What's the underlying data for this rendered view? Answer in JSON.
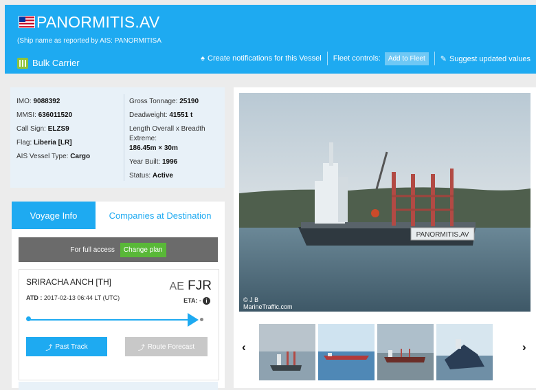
{
  "header": {
    "vessel_name": "PANORMITIS.AV",
    "reported_name": "(Ship name as reported by AIS: PANORMITISA",
    "vessel_type": "Bulk Carrier",
    "actions": {
      "create_notifications": "Create notifications for this Vessel",
      "fleet_controls": "Fleet controls:",
      "add_to_fleet": "Add to Fleet",
      "suggest_values": "Suggest updated values"
    }
  },
  "info": {
    "imo": {
      "label": "IMO:",
      "value": "9088392"
    },
    "mmsi": {
      "label": "MMSI:",
      "value": "636011520"
    },
    "callsign": {
      "label": "Call Sign:",
      "value": "ELZS9"
    },
    "flag": {
      "label": "Flag:",
      "value": "Liberia [LR]"
    },
    "ais_type": {
      "label": "AIS Vessel Type:",
      "value": "Cargo"
    },
    "gross_tonnage": {
      "label": "Gross Tonnage:",
      "value": "25190"
    },
    "deadweight": {
      "label": "Deadweight:",
      "value": "41551 t"
    },
    "length_label": "Length Overall x Breadth Extreme:",
    "length_value": "186.45m × 30m",
    "year_built": {
      "label": "Year Built:",
      "value": "1996"
    },
    "status": {
      "label": "Status:",
      "value": "Active"
    }
  },
  "tabs": {
    "voyage": "Voyage Info",
    "companies": "Companies at Destination"
  },
  "voyage": {
    "full_access": "For full access",
    "change_plan": "Change plan",
    "from": "SRIRACHA ANCH [TH]",
    "atd_label": "ATD :",
    "atd_value": "2017-02-13 06:44 LT (UTC)",
    "dest_code_a": "AE",
    "dest_code_b": "FJR",
    "eta_label": "ETA: -",
    "past_track": "Past Track",
    "route_forecast": "Route Forecast",
    "progress": 1.0
  },
  "photo": {
    "credit_1": "© J B",
    "credit_2": "MarineTraffic.com",
    "ship_label": "PANORMITIS.AV"
  },
  "colors": {
    "accent": "#1eaaf1",
    "green": "#59b838",
    "type_badge": "#8fc33a"
  }
}
